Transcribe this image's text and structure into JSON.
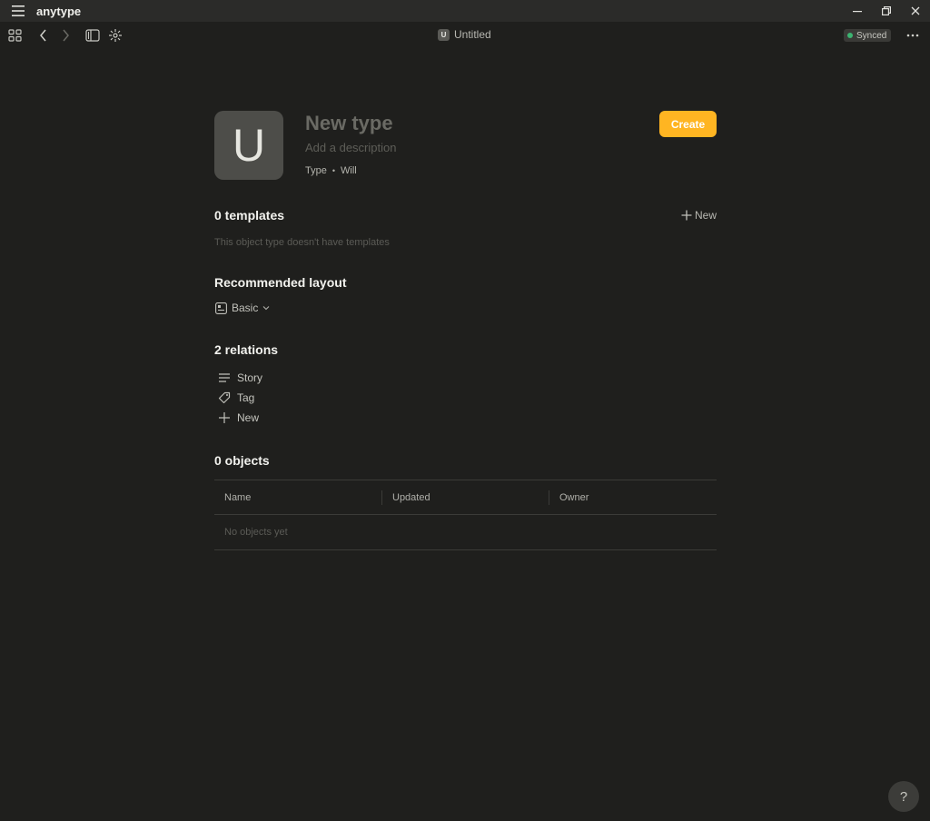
{
  "window": {
    "app_name": "anytype"
  },
  "toolbar": {
    "page_icon_letter": "U",
    "page_title": "Untitled",
    "sync_status": "Synced"
  },
  "type": {
    "icon_letter": "U",
    "name_placeholder": "New type",
    "description_placeholder": "Add a description",
    "meta_kind": "Type",
    "meta_bullet": "•",
    "meta_author": "Will",
    "create_label": "Create"
  },
  "templates": {
    "title": "0 templates",
    "new_label": "New",
    "empty_text": "This object type doesn't have templates"
  },
  "layout": {
    "title": "Recommended layout",
    "value": "Basic"
  },
  "relations": {
    "title": "2 relations",
    "items": [
      {
        "label": "Story",
        "icon": "lines-icon"
      },
      {
        "label": "Tag",
        "icon": "tag-icon"
      }
    ],
    "new_label": "New"
  },
  "objects": {
    "title": "0 objects",
    "columns": [
      "Name",
      "Updated",
      "Owner"
    ],
    "empty_text": "No objects yet"
  },
  "help": {
    "label": "?"
  },
  "colors": {
    "accent": "#ffb522",
    "background": "#1f1f1d",
    "synced_dot": "#3cb371"
  }
}
